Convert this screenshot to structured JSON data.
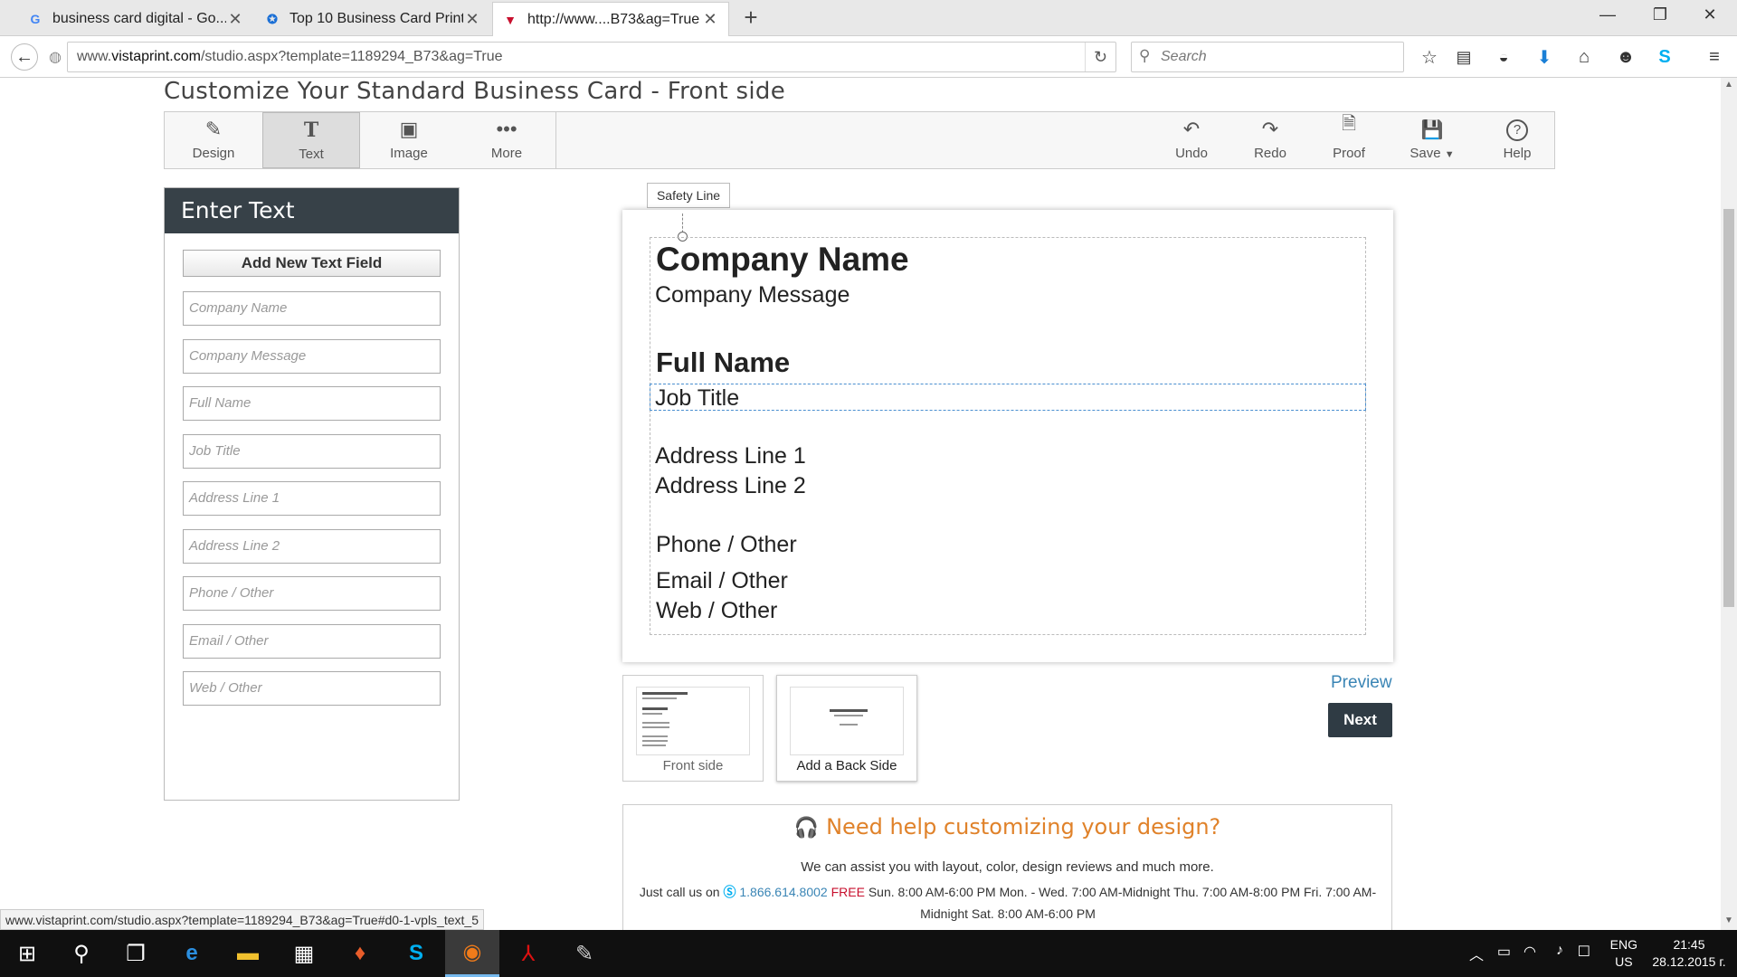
{
  "browser": {
    "tabs": [
      {
        "title": "business card digital - Go...",
        "favicon": "google-icon"
      },
      {
        "title": "Top 10 Business Card Print...",
        "favicon": "site-icon"
      },
      {
        "title": "http://www....B73&ag=True",
        "favicon": "vistaprint-icon"
      }
    ],
    "url_prefix": "www.",
    "url_domain": "vistaprint.com",
    "url_rest": "/studio.aspx?template=1189294_B73&ag=True",
    "search_placeholder": "Search"
  },
  "page": {
    "title": "Customize Your Standard Business Card - Front side",
    "toolbar_left": [
      {
        "label": "Design",
        "icon": "pencil-icon"
      },
      {
        "label": "Text",
        "icon": "text-icon"
      },
      {
        "label": "Image",
        "icon": "image-icon"
      },
      {
        "label": "More",
        "icon": "more-icon"
      }
    ],
    "toolbar_right": [
      {
        "label": "Undo",
        "icon": "undo-icon"
      },
      {
        "label": "Redo",
        "icon": "redo-icon"
      },
      {
        "label": "Proof",
        "icon": "proof-icon"
      },
      {
        "label": "Save",
        "icon": "save-icon"
      },
      {
        "label": "Help",
        "icon": "help-icon"
      }
    ],
    "panel": {
      "heading": "Enter Text",
      "add_button": "Add New Text Field",
      "fields": [
        "Company Name",
        "Company Message",
        "Full Name",
        "Job Title",
        "Address Line 1",
        "Address Line 2",
        "Phone / Other",
        "Email / Other",
        "Web / Other"
      ]
    },
    "safety_line_label": "Safety Line",
    "card": {
      "company_name": "Company Name",
      "company_message": "Company Message",
      "full_name": "Full Name",
      "job_title": "Job Title",
      "address1": "Address Line 1",
      "address2": "Address Line 2",
      "phone": "Phone / Other",
      "email": "Email / Other",
      "web": "Web / Other"
    },
    "thumbs": {
      "front": "Front side",
      "back": "Add a Back Side"
    },
    "preview": "Preview",
    "next": "Next",
    "help": {
      "title": "Need help customizing your design?",
      "sub": "We can assist you with layout, color, design reviews and much more.",
      "call_prefix": "Just call us on",
      "phone": "1.866.614.8002",
      "free": "FREE",
      "hours": "Sun. 8:00 AM-6:00 PM Mon. - Wed. 7:00 AM-Midnight Thu. 7:00 AM-8:00 PM Fri. 7:00 AM-Midnight Sat. 8:00 AM-6:00 PM"
    }
  },
  "status_url": "www.vistaprint.com/studio.aspx?template=1189294_B73&ag=True#d0-1-vpls_text_5",
  "taskbar": {
    "lang1": "ENG",
    "lang2": "US",
    "time": "21:45",
    "date": "28.12.2015 г."
  },
  "colors": {
    "accent_orange": "#e0822a",
    "link_blue": "#3a85b5",
    "panel_dark": "#374148"
  }
}
